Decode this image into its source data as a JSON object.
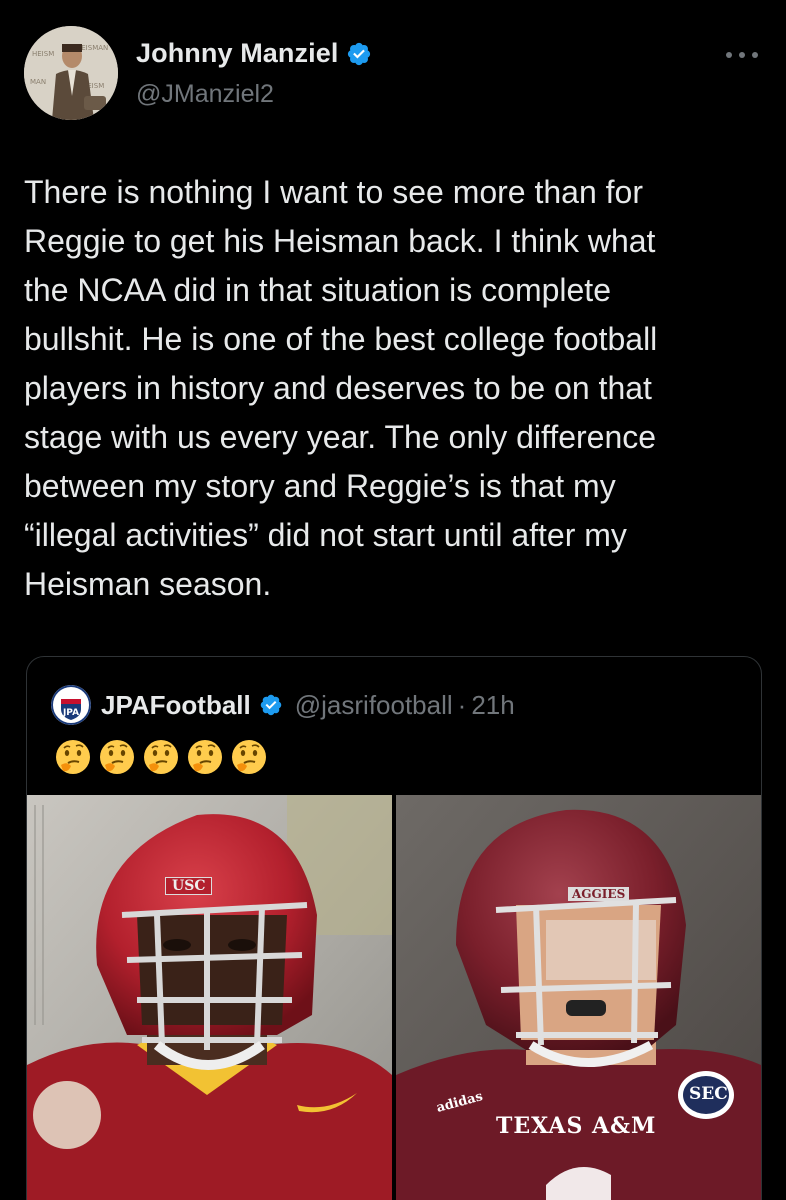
{
  "tweet": {
    "author_name": "Johnny Manziel",
    "author_handle": "@JManziel2",
    "verified_color": "#1d9bf0",
    "more_icon": "more-icon",
    "text": "There is nothing I want to see more than for\nReggie to get his Heisman back.  I think what\nthe NCAA did in that situation is complete\nbullshit. He is one of the best college football\nplayers in history and deserves to be on that\nstage with us every year. The only difference\nbetween my story and Reggie’s is that my\n“illegal activities” did not start until after my\nHeisman season."
  },
  "quote": {
    "author_name": "JPAFootball",
    "author_handle": "@jasrifootball",
    "separator": "·",
    "time": "21h",
    "emojis": [
      "🤔",
      "🤔",
      "🤔",
      "🤔",
      "🤔"
    ],
    "avatar_text": "JPA",
    "photos": {
      "left": {
        "helmet_text": "USC",
        "colors": {
          "helmet": "#b3202d",
          "jersey": "#9e1b25",
          "accent": "#f2c233"
        }
      },
      "right": {
        "helmet_text": "AGGIES",
        "jersey_text": "TEXAS A&M",
        "brand_text": "adidas",
        "badge_text": "SEC",
        "colors": {
          "helmet": "#7a1f2b",
          "jersey": "#6d1a27"
        }
      }
    }
  },
  "colors": {
    "background": "#000000",
    "text_primary": "#e7e9ea",
    "text_secondary": "#71767b",
    "border": "#2f3336"
  }
}
